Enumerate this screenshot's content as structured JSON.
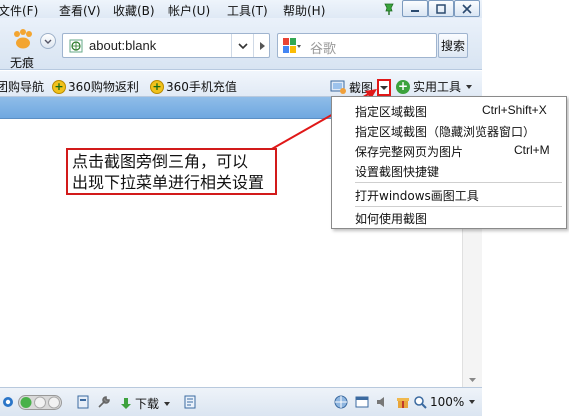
{
  "menubar": {
    "items": [
      "文件(F)",
      "查看(V)",
      "收藏(B)",
      "帐户(U)",
      "工具(T)",
      "帮助(H)"
    ],
    "window_buttons": [
      "minimize",
      "maximize",
      "close"
    ]
  },
  "addressbar": {
    "incognito_label": "无痕",
    "url": "about:blank",
    "search_placeholder": "谷歌",
    "search_button": "搜索"
  },
  "favorites": {
    "items": [
      "团购导航",
      "360购物返利",
      "360手机充值"
    ],
    "screenshot_label": "截图",
    "tools_label": "实用工具"
  },
  "callout": {
    "line1": "点击截图旁倒三角，可以",
    "line2": "出现下拉菜单进行相关设置"
  },
  "dropdown": {
    "items": [
      {
        "label": "指定区域截图",
        "shortcut": "Ctrl+Shift+X"
      },
      {
        "label": "指定区域截图（隐藏浏览器窗口）",
        "shortcut": ""
      },
      {
        "label": "保存完整网页为图片",
        "shortcut": "Ctrl+M"
      },
      {
        "label": "设置截图快捷键",
        "shortcut": ""
      },
      {
        "label": "打开windows画图工具",
        "shortcut": ""
      },
      {
        "label": "如何使用截图",
        "shortcut": ""
      }
    ]
  },
  "statusbar": {
    "download_label": "下载",
    "zoom": "100%"
  },
  "colors": {
    "callout_border": "#d21a1a",
    "tab_strip": "#7fb2e4"
  }
}
